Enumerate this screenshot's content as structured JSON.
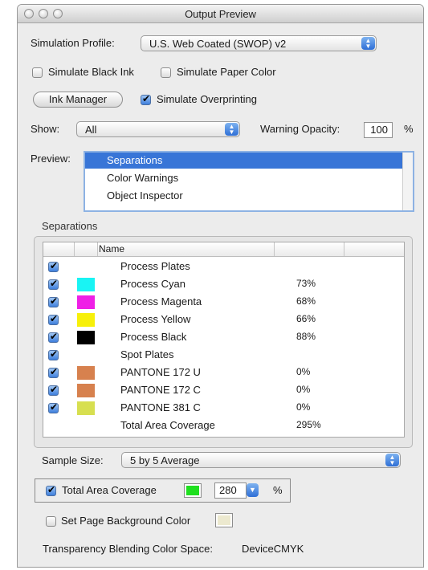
{
  "window": {
    "title": "Output Preview"
  },
  "simulation_profile": {
    "label": "Simulation Profile:",
    "value": "U.S. Web Coated (SWOP) v2"
  },
  "simulate_black_ink": {
    "label": "Simulate Black Ink",
    "checked": false
  },
  "simulate_paper_color": {
    "label": "Simulate Paper Color",
    "checked": false
  },
  "ink_manager": {
    "label": "Ink Manager"
  },
  "simulate_overprinting": {
    "label": "Simulate Overprinting",
    "checked": true
  },
  "show": {
    "label": "Show:",
    "value": "All"
  },
  "warning_opacity": {
    "label": "Warning Opacity:",
    "value": "100",
    "unit": "%"
  },
  "preview": {
    "label": "Preview:",
    "items": [
      "Separations",
      "Color Warnings",
      "Object Inspector"
    ],
    "selected": 0
  },
  "separations": {
    "group_label": "Separations",
    "header": {
      "name": "Name"
    },
    "rows": [
      {
        "name": "Process Plates",
        "checked": true,
        "color": null,
        "coverage": ""
      },
      {
        "name": "Process Cyan",
        "checked": true,
        "color": "#19f4f4",
        "coverage": "73%"
      },
      {
        "name": "Process Magenta",
        "checked": true,
        "color": "#ef1fe6",
        "coverage": "68%"
      },
      {
        "name": "Process Yellow",
        "checked": true,
        "color": "#f7f00a",
        "coverage": "66%"
      },
      {
        "name": "Process Black",
        "checked": true,
        "color": "#000000",
        "coverage": "88%"
      },
      {
        "name": "Spot Plates",
        "checked": true,
        "color": null,
        "coverage": ""
      },
      {
        "name": "PANTONE 172 U",
        "checked": true,
        "color": "#d7814e",
        "coverage": "0%"
      },
      {
        "name": "PANTONE 172 C",
        "checked": true,
        "color": "#d7814e",
        "coverage": "0%"
      },
      {
        "name": "PANTONE 381 C",
        "checked": true,
        "color": "#d7df50",
        "coverage": "0%"
      },
      {
        "name": "Total Area Coverage",
        "checked": false,
        "color": null,
        "coverage": "295%"
      }
    ]
  },
  "sample_size": {
    "label": "Sample Size:",
    "value": "5 by 5 Average"
  },
  "total_area_coverage": {
    "label": "Total Area Coverage",
    "checked": true,
    "color": "#1fe01f",
    "value": "280",
    "unit": "%"
  },
  "set_page_background": {
    "label": "Set Page Background Color",
    "checked": false,
    "color": "#ece9cf"
  },
  "transparency": {
    "label": "Transparency Blending Color Space:",
    "value": "DeviceCMYK"
  },
  "icons": {
    "checkmark": "checkmark-icon",
    "updown": "up-down-arrows-icon",
    "dropdown": "dropdown-arrow-icon"
  }
}
